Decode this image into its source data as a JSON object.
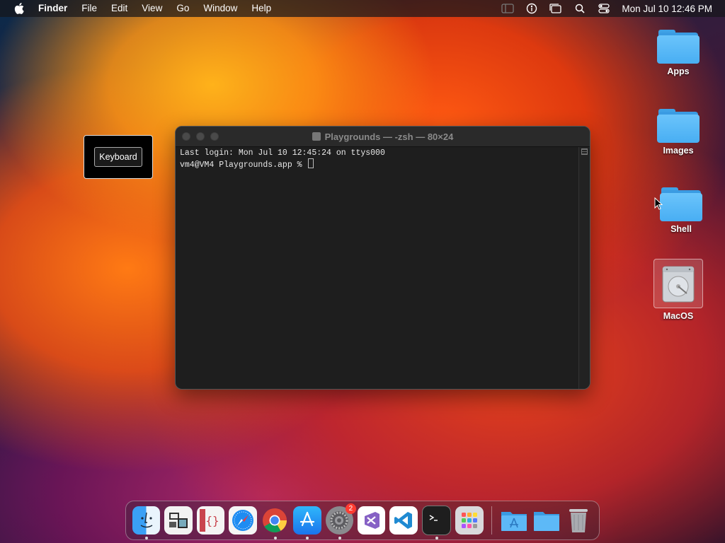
{
  "menubar": {
    "app_name": "Finder",
    "menus": [
      "File",
      "Edit",
      "View",
      "Go",
      "Window",
      "Help"
    ],
    "clock": "Mon Jul 10  12:46 PM",
    "status_icons": [
      "sidebar-icon",
      "accessibility-icon",
      "window-icon",
      "search-icon",
      "control-center-icon"
    ]
  },
  "keyboard_widget": {
    "label": "Keyboard"
  },
  "terminal": {
    "title": "Playgrounds — -zsh — 80×24",
    "lines": [
      "Last login: Mon Jul 10 12:45:24 on ttys000",
      "vm4@VM4 Playgrounds.app % "
    ]
  },
  "desktop": {
    "icons": [
      {
        "label": "Apps",
        "type": "folder"
      },
      {
        "label": "Images",
        "type": "folder"
      },
      {
        "label": "Shell",
        "type": "folder"
      },
      {
        "label": "MacOS",
        "type": "disk",
        "selected": true
      }
    ]
  },
  "dock": {
    "items": [
      {
        "name": "finder",
        "running": true
      },
      {
        "name": "preview",
        "running": false
      },
      {
        "name": "script-editor",
        "running": false
      },
      {
        "name": "safari",
        "running": false
      },
      {
        "name": "chrome",
        "running": true
      },
      {
        "name": "app-store",
        "running": true
      },
      {
        "name": "system-settings",
        "running": true,
        "badge": "2"
      },
      {
        "name": "visual-studio",
        "running": false
      },
      {
        "name": "vscode",
        "running": false
      },
      {
        "name": "terminal",
        "running": true
      },
      {
        "name": "launchpad",
        "running": false
      },
      {
        "name": "applications-folder",
        "running": false
      },
      {
        "name": "folder",
        "running": false
      },
      {
        "name": "trash",
        "running": false
      }
    ]
  }
}
